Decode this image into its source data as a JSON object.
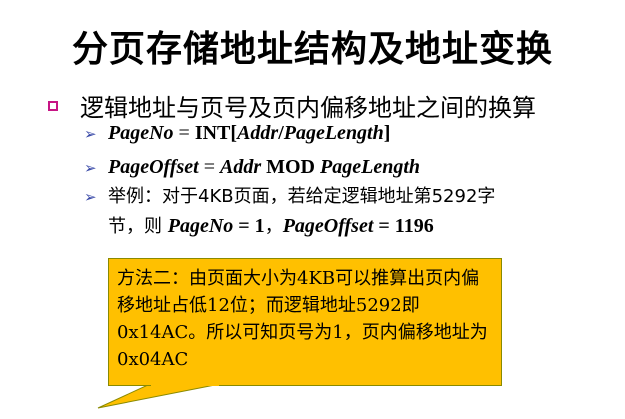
{
  "title": "分页存储地址结构及地址变换",
  "bullet": {
    "icon": "square-bullet-icon",
    "color": "#c71585",
    "text": "逻辑地址与页号及页内偏移地址之间的换算"
  },
  "sub_items": [
    {
      "arrow": "➢",
      "var": "PageNo",
      "eq": " = ",
      "func": "INT[",
      "arg1": "Addr",
      "slash": "/",
      "arg2": "PageLength",
      "end": "]"
    },
    {
      "arrow": "➢",
      "var": "PageOffset",
      "eq": " = ",
      "arg1": "Addr",
      "op": " MOD ",
      "arg2": "PageLength"
    },
    {
      "arrow": "➢",
      "line1": "举例：对于4KB页面，若给定逻辑地址第5292字",
      "line2_prefix": "节，则 ",
      "pageno_label": "PageNo",
      "pageno_value": " = 1",
      "sep": "，",
      "offset_label": "PageOffset",
      "offset_value": " = 1196"
    }
  ],
  "callout": {
    "text": "方法二：由页面大小为4KB可以推算出页内偏移地址占低12位；而逻辑地址5292即0x14AC。所以可知页号为1，页内偏移地址为0x04AC",
    "fill": "#ffc000"
  }
}
